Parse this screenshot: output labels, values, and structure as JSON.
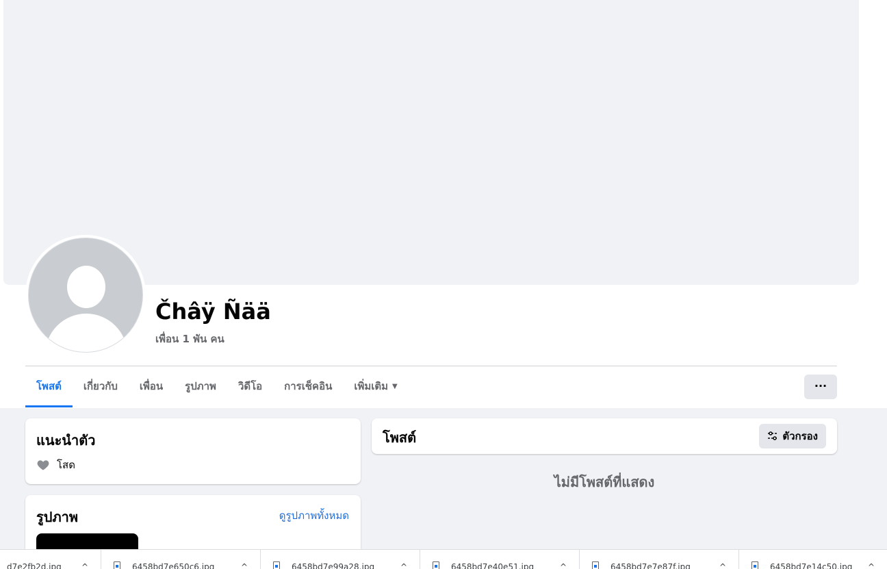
{
  "profile": {
    "name": "Čhâÿ Ñää",
    "friends": "เพื่อน 1 พัน คน"
  },
  "tabs": [
    {
      "label": "โพสต์",
      "active": true
    },
    {
      "label": "เกี่ยวกับ"
    },
    {
      "label": "เพื่อน"
    },
    {
      "label": "รูปภาพ"
    },
    {
      "label": "วิดีโอ"
    },
    {
      "label": "การเช็คอิน"
    },
    {
      "label": "เพิ่มเติม"
    }
  ],
  "more_button": "···",
  "intro": {
    "title": "แนะนำตัว",
    "relationship": "โสด",
    "relationship_icon": "heart-icon"
  },
  "photos": {
    "title": "รูปภาพ",
    "see_all": "ดูรูปภาพทั้งหมด"
  },
  "posts": {
    "title": "โพสต์",
    "filter": "ตัวกรอง",
    "empty": "ไม่มีโพสต์ที่แสดง"
  },
  "downloads": [
    {
      "name": "d7e2fb2d.jpg"
    },
    {
      "name": "6458bd7e650c6.jpg"
    },
    {
      "name": "6458bd7e99a28.jpg"
    },
    {
      "name": "6458bd7e40e51.jpg"
    },
    {
      "name": "6458bd7e7e87f.jpg"
    },
    {
      "name": "6458bd7e14c50.jpg"
    }
  ],
  "colors": {
    "accent": "#1877f2",
    "secondary_text": "#65676b",
    "background": "#f0f2f5"
  }
}
